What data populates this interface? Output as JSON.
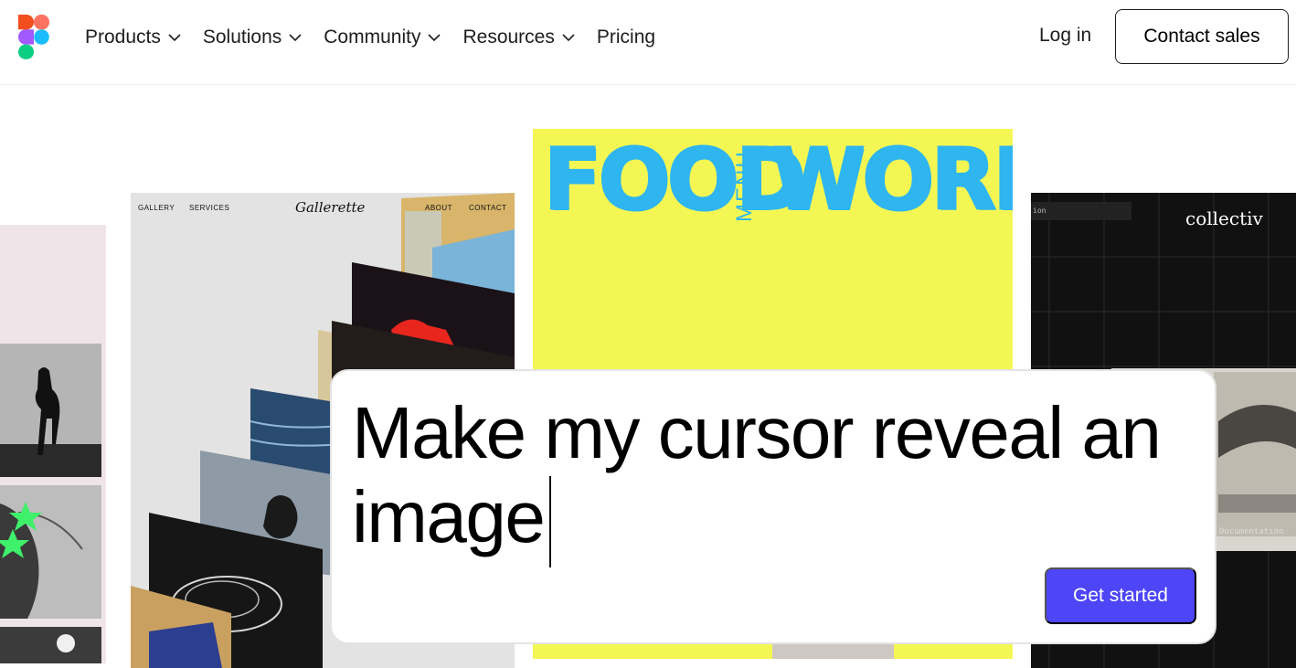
{
  "nav": {
    "logo_icon": "figma-logo-icon",
    "items": [
      {
        "label": "Products",
        "has_dropdown": true
      },
      {
        "label": "Solutions",
        "has_dropdown": true
      },
      {
        "label": "Community",
        "has_dropdown": true
      },
      {
        "label": "Resources",
        "has_dropdown": true
      },
      {
        "label": "Pricing",
        "has_dropdown": false
      }
    ],
    "login_label": "Log in",
    "contact_label": "Contact sales"
  },
  "gallery_card": {
    "nav_left": [
      "GALLERY",
      "SERVICES"
    ],
    "logo": "Gallerette",
    "nav_right": [
      "ABOUT",
      "CONTACT"
    ]
  },
  "food_card": {
    "word_left": "FOOD",
    "word_middle": "MENU",
    "word_right": "WORKS"
  },
  "collectiv_card": {
    "logo": "collectiv",
    "tag": "ion",
    "doc_label": "Documentation"
  },
  "prompt": {
    "text": "Make my cursor reveal an image",
    "button_label": "Get started"
  },
  "colors": {
    "button_bg": "#4d45f6",
    "food_bg": "#f4f753",
    "food_text": "#2fb5f0",
    "pink_card": "#efe5e9",
    "dark_card": "#111111"
  }
}
